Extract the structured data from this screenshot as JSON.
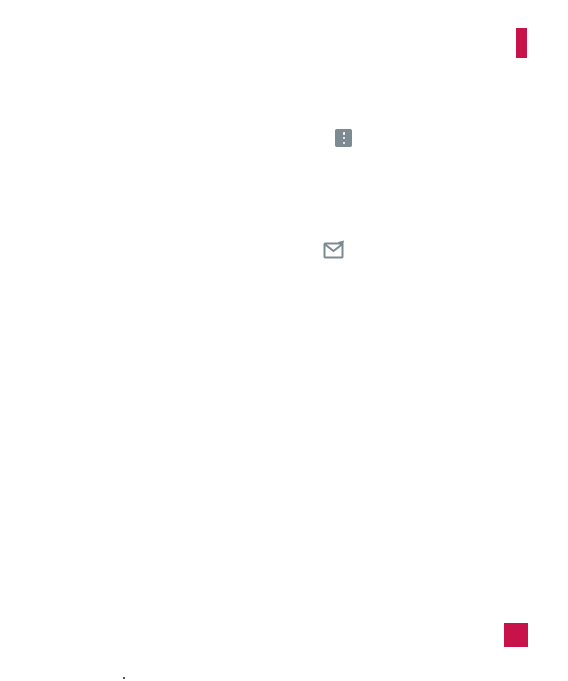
{
  "colors": {
    "accent": "#c8134a",
    "icon": "#7d8a92",
    "background": "#ffffff"
  },
  "icons": {
    "menu": "more-vertical-icon",
    "mail": "email-send-icon"
  },
  "decor": {
    "edge_tab": "section-tab",
    "page_badge": "page-number-badge"
  }
}
